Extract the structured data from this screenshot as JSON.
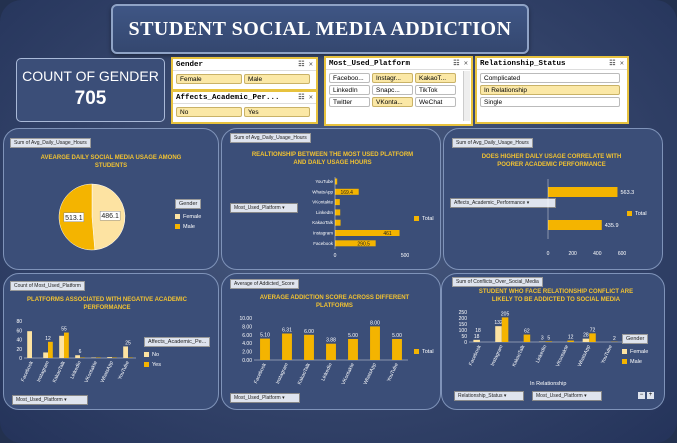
{
  "dashboard": {
    "title": "STUDENT SOCIAL MEDIA ADDICTION",
    "kpi": {
      "label": "COUNT OF GENDER",
      "value": "705"
    }
  },
  "slicers": {
    "gender": {
      "title": "Gender",
      "items": [
        "Female",
        "Male"
      ]
    },
    "academic": {
      "title": "Affects_Academic_Per...",
      "items": [
        "No",
        "Yes"
      ]
    },
    "platform": {
      "title": "Most_Used_Platform",
      "items": [
        "Faceboo...",
        "Instagr...",
        "KakaoT...",
        "LinkedIn",
        "Snapc...",
        "TikTok",
        "Twitter",
        "VKonta...",
        "WeChat"
      ]
    },
    "relationship": {
      "title": "Relationship_Status",
      "items": [
        "Complicated",
        "In Relationship",
        "Single"
      ]
    }
  },
  "colors": {
    "accent": "#f1c232",
    "pie_light": "#fde3a2",
    "bar": "#f4b400",
    "panel": "#3b4e78"
  },
  "panels": {
    "p1": {
      "tag": "Sum of Avg_Daily_Usage_Hours",
      "legend_title": "Gender"
    },
    "p2": {
      "tag": "Sum of Avg_Daily_Usage_Hours",
      "filter": "Most_Used_Platform",
      "legend": "Total"
    },
    "p3": {
      "tag": "Sum of Avg_Daily_Usage_Hours",
      "filter": "Affects_Academic_Performance",
      "legend": "Total"
    },
    "p4": {
      "tag": "Count of Most_Used_Platform",
      "filter": "Most_Used_Platform",
      "legend_title": "Affects_Academic_Pe..."
    },
    "p5": {
      "tag": "Average of Addicted_Score",
      "filter": "Most_Used_Platform",
      "legend": "Total"
    },
    "p6": {
      "tag": "Sum of Conflicts_Over_Social_Media",
      "filter1": "Relationship_Status",
      "filter2": "Most_Used_Platform",
      "legend_title": "Gender",
      "axis_group": "In Relationship"
    }
  },
  "chart_data": [
    {
      "type": "pie",
      "title": "AVEARGE DAILY SOCIAL MEDIA USAGE AMONG STUDENTS",
      "categories": [
        "Female",
        "Male"
      ],
      "values": [
        486.1,
        513.1
      ]
    },
    {
      "type": "bar",
      "orientation": "horizontal",
      "title": "REALTIONSHIP BETWEEN THE MOST USED PLATFORM AND DAILY USAGE HOURS",
      "categories": [
        "YouTube",
        "WhatsApp",
        "VKontakte",
        "LinkedIn",
        "KakaoTalk",
        "Instagram",
        "Facebook"
      ],
      "values": [
        15.7,
        169.4,
        34.4,
        37.3,
        39.8,
        461,
        290.5
      ],
      "labels": [
        "",
        "169.4",
        "",
        "",
        "",
        "461",
        "290.5"
      ],
      "xticks": [
        "0",
        "500"
      ],
      "xlim": [
        0,
        500
      ],
      "series": [
        {
          "name": "Total"
        }
      ]
    },
    {
      "type": "bar",
      "orientation": "horizontal",
      "title": "DOES HIGHER DAILY USAGE CORRELATE WITH POORER ACADEMIC PERFORMANCE",
      "categories": [
        "",
        ""
      ],
      "values": [
        563.3,
        435.9
      ],
      "xticks": [
        "0",
        "200",
        "400",
        "600"
      ],
      "xlim": [
        0,
        600
      ],
      "series": [
        {
          "name": "Total"
        }
      ]
    },
    {
      "type": "bar",
      "title": "PLATFORMS ASSOCIATED WITH NEGATIVE ACADEMIC PERFORMANCE",
      "categories": [
        "Facebook",
        "Instagram",
        "KakaoTalk",
        "LinkedIn",
        "VKontakte",
        "WhatsApp",
        "YouTube"
      ],
      "yticks": [
        "0",
        "20",
        "40",
        "60",
        "80"
      ],
      "ylim": [
        0,
        80
      ],
      "series": [
        {
          "name": "No",
          "values": [
            58,
            12,
            48,
            6,
            1,
            2,
            25
          ]
        },
        {
          "name": "Yes",
          "values": [
            0,
            35,
            55,
            1,
            1,
            1,
            1
          ]
        }
      ],
      "labels": [
        "",
        "12",
        "55",
        "6",
        "",
        "",
        "25"
      ]
    },
    {
      "type": "bar",
      "title": "AVERAGE ADDICTION SCORE ACROSS DIFFERENT PLATFORMS",
      "categories": [
        "Facebook",
        "Instagram",
        "KakaoTalk",
        "LinkedIn",
        "VKontakte",
        "WhatsApp",
        "YouTube"
      ],
      "values": [
        5.1,
        6.31,
        6.0,
        3.88,
        5.0,
        8.0,
        5.0
      ],
      "labels": [
        "5.10",
        "6.31",
        "6.00",
        "3.88",
        "5.00",
        "8.00",
        "5.00"
      ],
      "yticks": [
        "0.00",
        "2.00",
        "4.00",
        "6.00",
        "8.00",
        "10.00"
      ],
      "ylim": [
        0,
        10
      ],
      "series": [
        {
          "name": "Total"
        }
      ]
    },
    {
      "type": "bar",
      "title": "STUDENT WHO FACE RELATIONSHIP CONFLICT ARE LIKELY TO BE ADDICTED TO SOCIAL MEDIA",
      "categories": [
        "Facebook",
        "Instagram",
        "KakaoTalk",
        "LinkedIn",
        "VKontakte",
        "WhatsApp",
        "YouTube"
      ],
      "yticks": [
        "0",
        "50",
        "100",
        "150",
        "200",
        "250"
      ],
      "ylim": [
        0,
        250
      ],
      "series": [
        {
          "name": "Female",
          "values": [
            18,
            132,
            0,
            3,
            0,
            28,
            0
          ]
        },
        {
          "name": "Male",
          "values": [
            0,
            205,
            62,
            5,
            12,
            72,
            2
          ]
        }
      ],
      "labels": [
        [
          "18",
          ""
        ],
        [
          "132",
          "205"
        ],
        [
          "",
          "62"
        ],
        [
          "3",
          "5"
        ],
        [
          "",
          "12"
        ],
        [
          "28",
          "72"
        ],
        [
          "",
          "2"
        ]
      ],
      "extra_label": "18"
    }
  ]
}
